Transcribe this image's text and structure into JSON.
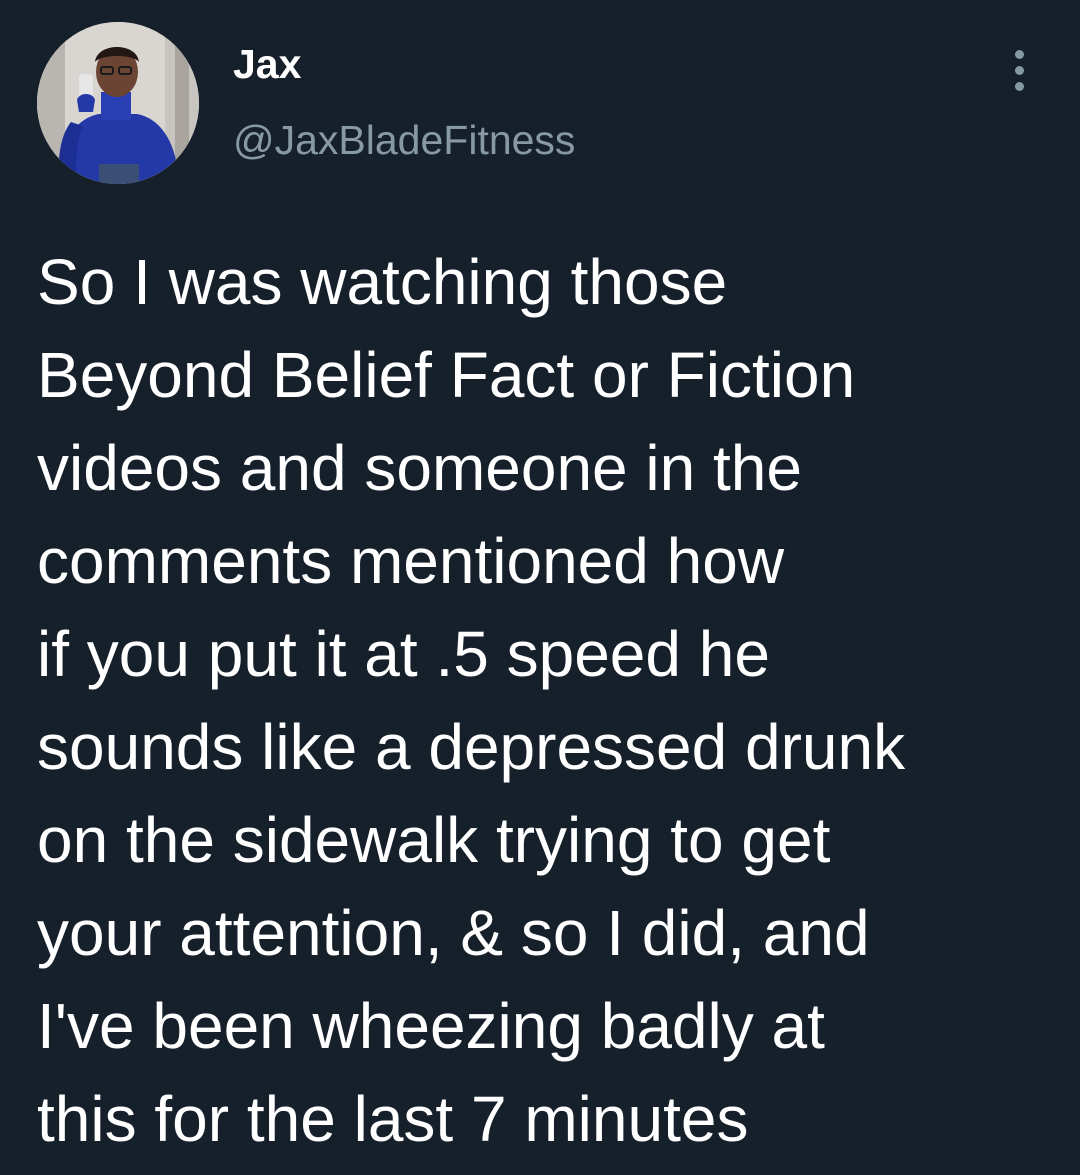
{
  "tweet": {
    "author": {
      "display_name": "Jax",
      "handle": "@JaxBladeFitness",
      "avatar_icon": "profile-photo-avatar"
    },
    "more_icon": "more-options-icon",
    "text": "So I was watching those\nBeyond Belief Fact or Fiction\nvideos and someone in the\ncomments mentioned how\nif you put it at .5 speed he\nsounds like a depressed drunk\non the sidewalk trying to get\nyour attention, & so I did, and\nI've been wheezing badly at\nthis for the last 7 minutes"
  },
  "colors": {
    "background": "#15202b",
    "primary_text": "#ffffff",
    "secondary_text": "#8899a6"
  }
}
